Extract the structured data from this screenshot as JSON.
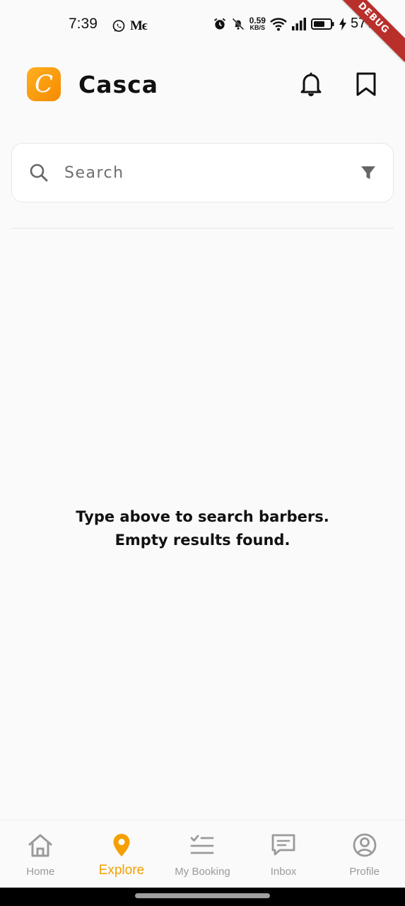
{
  "status_bar": {
    "time": "7:39",
    "notif_text": "Mϵ",
    "net_speed_value": "0.59",
    "net_speed_unit": "KB/S",
    "battery_percent": "57%",
    "debug_label": "DEBUG"
  },
  "app_bar": {
    "logo_letter": "C",
    "title": "Casca",
    "accent_color": "#f5a000"
  },
  "search": {
    "placeholder": "Search",
    "value": ""
  },
  "empty_state": {
    "line1": "Type above to search barbers.",
    "line2": "Empty results found."
  },
  "nav": {
    "items": [
      {
        "label": "Home",
        "icon": "home-icon",
        "active": false
      },
      {
        "label": "Explore",
        "icon": "location-pin-icon",
        "active": true
      },
      {
        "label": "My Booking",
        "icon": "booking-list-icon",
        "active": false
      },
      {
        "label": "Inbox",
        "icon": "chat-icon",
        "active": false
      },
      {
        "label": "Profile",
        "icon": "profile-icon",
        "active": false
      }
    ]
  }
}
